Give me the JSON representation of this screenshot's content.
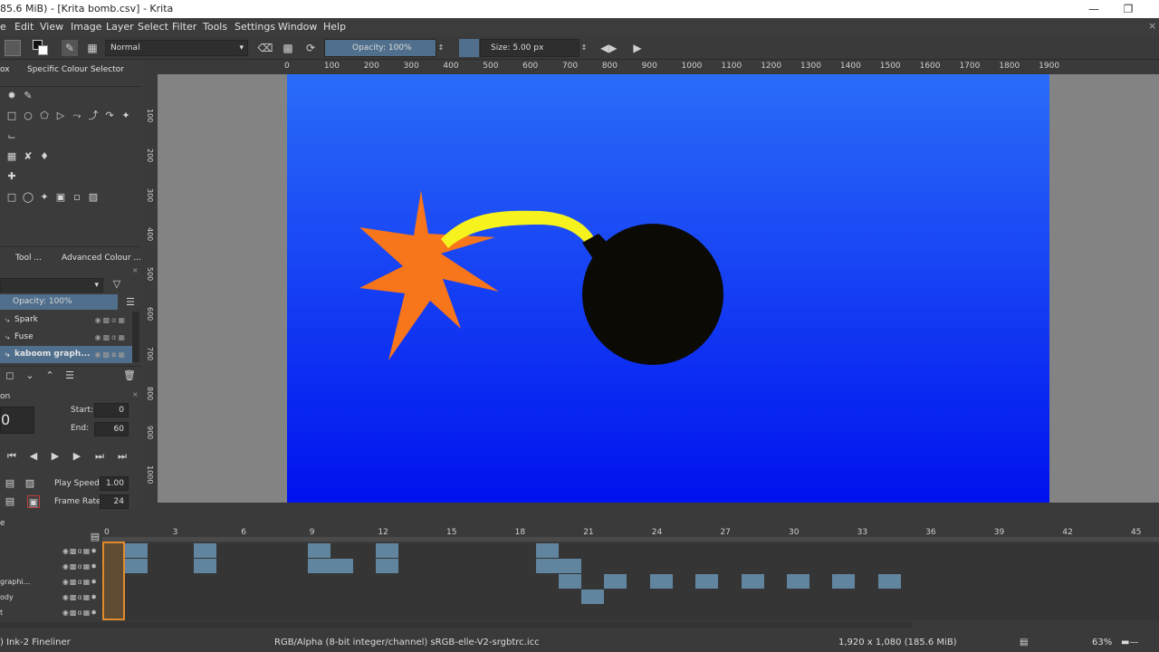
{
  "window": {
    "title": "85.6 MiB)  - [Krita bomb.csv] - Krita"
  },
  "menu": [
    "e",
    "Edit",
    "View",
    "Image",
    "Layer",
    "Select",
    "Filter",
    "Tools",
    "Settings",
    "Window",
    "Help"
  ],
  "toolbar": {
    "blend_mode": "Normal",
    "opacity": "Opacity: 100%",
    "size": "Size: 5.00 px"
  },
  "dock_tabs": {
    "toolbox": "ox",
    "colour_selector": "Specific Colour Selector",
    "tool_options": "Tool ...",
    "advanced_colour": "Advanced Colour ..."
  },
  "layers": {
    "opacity": "Opacity:  100%",
    "items": [
      {
        "name": "Spark"
      },
      {
        "name": "Fuse"
      },
      {
        "name": "kaboom graph..."
      }
    ]
  },
  "animation": {
    "section_label": "on",
    "current_frame": "0",
    "start_label": "Start:",
    "start_value": "0",
    "end_label": "End:",
    "end_value": "60",
    "play_speed_label": "Play Speed:",
    "play_speed_value": "1.00",
    "frame_rate_label": "Frame Rate:",
    "frame_rate_value": "24"
  },
  "ruler": {
    "h": [
      "0",
      "100",
      "200",
      "300",
      "400",
      "500",
      "600",
      "700",
      "800",
      "900",
      "1000",
      "1100",
      "1200",
      "1300",
      "1400",
      "1500",
      "1600",
      "1700",
      "1800",
      "1900"
    ],
    "v": [
      "100",
      "200",
      "300",
      "400",
      "500",
      "600",
      "700",
      "800",
      "900",
      "1000"
    ]
  },
  "timeline": {
    "frames": [
      "0",
      "3",
      "6",
      "9",
      "12",
      "15",
      "18",
      "21",
      "24",
      "27",
      "30",
      "33",
      "36",
      "39",
      "42",
      "45"
    ],
    "tracks": [
      "",
      "",
      "graphi...",
      "ody",
      "t"
    ],
    "corner": "e"
  },
  "status": {
    "brush": ") Ink-2 Fineliner",
    "colorspace": "RGB/Alpha (8-bit integer/channel)  sRGB-elle-V2-srgbtrc.icc",
    "image_size": "1,920 x 1,080 (185.6 MiB)",
    "zoom": "63%"
  },
  "colors": {
    "canvas_top": "#2a6cf8",
    "canvas_bottom": "#0012ef",
    "spark": "#f7751b",
    "fuse": "#f6f21d",
    "bomb": "#0b0a05",
    "keyframe": "#61849f"
  }
}
